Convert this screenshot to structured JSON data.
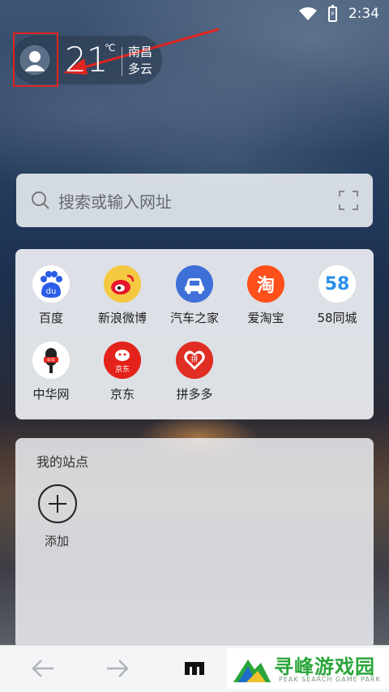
{
  "status_bar": {
    "time": "2:34"
  },
  "weather": {
    "temperature": "21",
    "unit": "℃",
    "city": "南昌",
    "condition": "多云"
  },
  "search": {
    "placeholder": "搜索或输入网址"
  },
  "quick_sites": [
    {
      "label": "百度",
      "icon": "baidu-icon",
      "color": "#2b5ee8"
    },
    {
      "label": "新浪微博",
      "icon": "weibo-icon",
      "color": "#f5c842"
    },
    {
      "label": "汽车之家",
      "icon": "autohome-icon",
      "color": "#3f6fd8"
    },
    {
      "label": "爱淘宝",
      "icon": "taobao-icon",
      "color": "#ff4f1a"
    },
    {
      "label": "58同城",
      "icon": "58-icon",
      "color": "#ffffff"
    },
    {
      "label": "中华网",
      "icon": "china-com-icon",
      "color": "#ffffff"
    },
    {
      "label": "京东",
      "icon": "jd-icon",
      "color": "#e3231b"
    },
    {
      "label": "拼多多",
      "icon": "pinduoduo-icon",
      "color": "#e02e24"
    }
  ],
  "icon_text": {
    "baidu": "du",
    "taobao": "淘",
    "s58": "58",
    "china": "中华",
    "jd": "京东",
    "pdd": "拼"
  },
  "my_sites": {
    "title": "我的站点",
    "add_label": "添加"
  },
  "brand": {
    "name": "寻峰游戏园",
    "sub": "PEAK SEARCH GAME PARK"
  }
}
